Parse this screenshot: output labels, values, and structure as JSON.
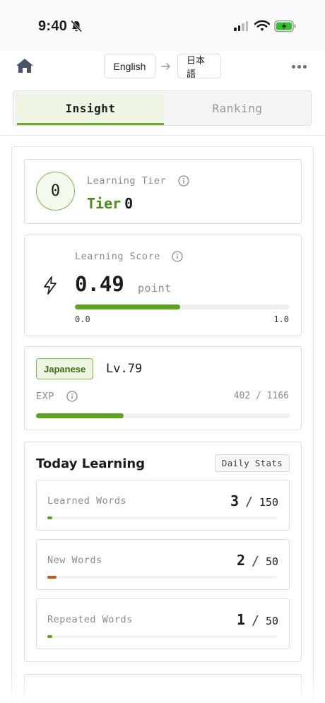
{
  "status_bar": {
    "time": "9:40"
  },
  "nav": {
    "source_lang": "English",
    "target_lang": "日本語"
  },
  "tabs": [
    {
      "label": "Insight",
      "active": true
    },
    {
      "label": "Ranking",
      "active": false
    }
  ],
  "tier": {
    "circle_value": "0",
    "label": "Learning Tier",
    "tier_word": "Tier",
    "tier_number": "0"
  },
  "score": {
    "label": "Learning Score",
    "value": "0.49",
    "unit": "point",
    "min": "0.0",
    "max": "1.0",
    "fraction": 0.49
  },
  "level": {
    "language": "Japanese",
    "level": "Lv.79",
    "exp_label": "EXP",
    "exp_current": 402,
    "exp_total": 1166,
    "exp_text": "402 / 1166"
  },
  "today": {
    "title": "Today Learning",
    "daily_stats_label": "Daily Stats",
    "rows": [
      {
        "label": "Learned Words",
        "value": "3",
        "total": "150",
        "fraction": 0.02,
        "color": "#5aa51b"
      },
      {
        "label": "New Words",
        "value": "2",
        "total": "50",
        "fraction": 0.04,
        "color": "#c9541e"
      },
      {
        "label": "Repeated Words",
        "value": "1",
        "total": "50",
        "fraction": 0.02,
        "color": "#5aa51b"
      }
    ]
  },
  "colors": {
    "accent": "#5aa51b",
    "accent_dark": "#4c8a1c",
    "tab_active_bg": "#eef6e3",
    "warning": "#c9541e"
  }
}
